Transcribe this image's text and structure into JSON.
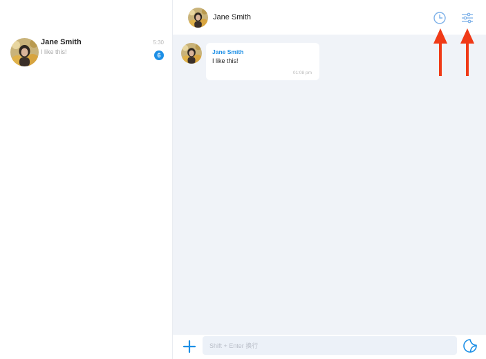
{
  "sidebar": {
    "conversations": [
      {
        "name": "Jane Smith",
        "time": "5:30",
        "preview": "I like this!",
        "unread": "6"
      }
    ]
  },
  "header": {
    "contact_name": "Jane Smith",
    "icons": [
      "clock-icon",
      "sliders-icon"
    ]
  },
  "messages": [
    {
      "sender": "Jane Smith",
      "text": "I like this!",
      "time": "01:08 pm"
    }
  ],
  "composer": {
    "placeholder": "Shift + Enter 换行",
    "icons": [
      "plus-icon",
      "sticker-icon"
    ]
  },
  "colors": {
    "accent": "#1c8fe6",
    "chat_background": "#f0f3f8",
    "annotation_arrow": "#f03a17"
  }
}
